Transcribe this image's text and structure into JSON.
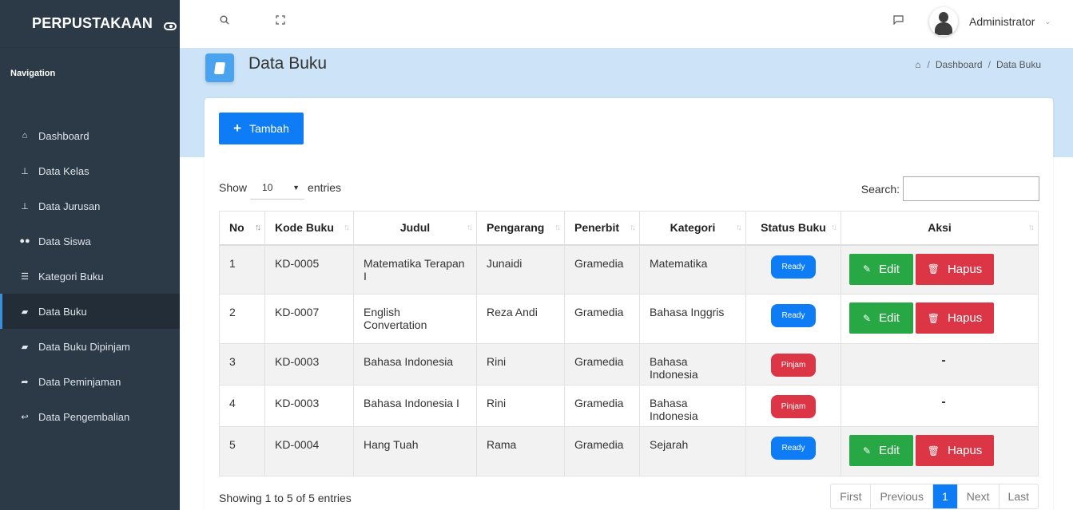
{
  "app": {
    "brand": "PERPUSTAKAAN"
  },
  "sidebar": {
    "nav_title": "Navigation",
    "items": [
      {
        "label": "Dashboard",
        "icon": "home-icon"
      },
      {
        "label": "Data Kelas",
        "icon": "sitemap-icon"
      },
      {
        "label": "Data Jurusan",
        "icon": "sitemap-icon"
      },
      {
        "label": "Data Siswa",
        "icon": "users-icon"
      },
      {
        "label": "Kategori Buku",
        "icon": "list-icon"
      },
      {
        "label": "Data Buku",
        "icon": "book-icon",
        "active": true
      },
      {
        "label": "Data Buku Dipinjam",
        "icon": "book-icon"
      },
      {
        "label": "Data Peminjaman",
        "icon": "share-icon"
      },
      {
        "label": "Data Pengembalian",
        "icon": "reply-icon"
      }
    ]
  },
  "topbar": {
    "user_name": "Administrator"
  },
  "page": {
    "title": "Data Buku",
    "breadcrumb": [
      "Dashboard",
      "Data Buku"
    ]
  },
  "toolbar": {
    "add_label": "Tambah"
  },
  "table_controls": {
    "show_label": "Show",
    "entries_value": "10",
    "entries_label": "entries",
    "search_label": "Search:",
    "search_value": ""
  },
  "table": {
    "columns": [
      "No",
      "Kode Buku",
      "Judul",
      "Pengarang",
      "Penerbit",
      "Kategori",
      "Status Buku",
      "Aksi"
    ],
    "rows": [
      {
        "no": "1",
        "kode": "KD-0005",
        "judul": "Matematika Terapan I",
        "pengarang": "Junaidi",
        "penerbit": "Gramedia",
        "kategori": "Matematika",
        "status": "Ready"
      },
      {
        "no": "2",
        "kode": "KD-0007",
        "judul": "English Convertation",
        "pengarang": "Reza Andi",
        "penerbit": "Gramedia",
        "kategori": "Bahasa Inggris",
        "status": "Ready"
      },
      {
        "no": "3",
        "kode": "KD-0003",
        "judul": "Bahasa Indonesia",
        "pengarang": "Rini",
        "penerbit": "Gramedia",
        "kategori": "Bahasa Indonesia",
        "status": "Pinjam"
      },
      {
        "no": "4",
        "kode": "KD-0003",
        "judul": "Bahasa Indonesia I",
        "pengarang": "Rini",
        "penerbit": "Gramedia",
        "kategori": "Bahasa Indonesia",
        "status": "Pinjam"
      },
      {
        "no": "5",
        "kode": "KD-0004",
        "judul": "Hang Tuah",
        "pengarang": "Rama",
        "penerbit": "Gramedia",
        "kategori": "Sejarah",
        "status": "Ready"
      }
    ],
    "edit_label": "Edit",
    "delete_label": "Hapus",
    "no_action": "-"
  },
  "footer": {
    "info": "Showing 1 to 5 of 5 entries",
    "pagination": [
      "First",
      "Previous",
      "1",
      "Next",
      "Last"
    ],
    "current_page": "1"
  },
  "colors": {
    "primary": "#0d7cf5",
    "success": "#28a745",
    "danger": "#dc3545",
    "sidebar": "#2c3a47",
    "banner": "#cde4f8"
  }
}
